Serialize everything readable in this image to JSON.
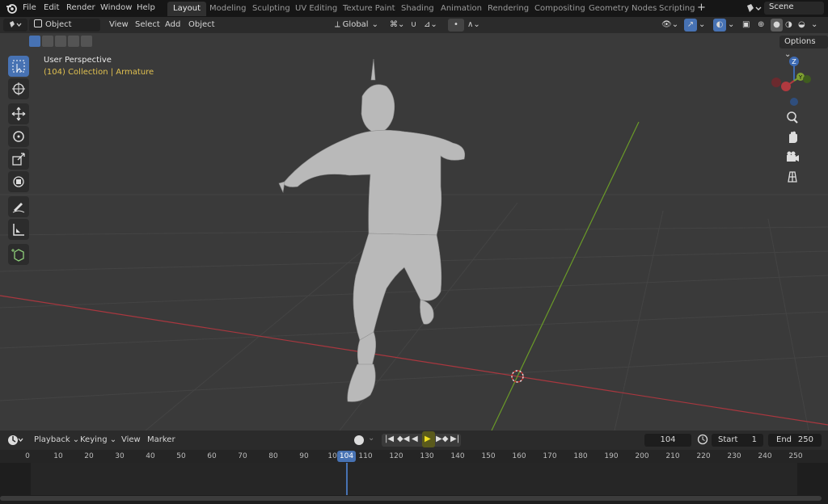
{
  "menu": {
    "items": [
      "File",
      "Edit",
      "Render",
      "Window",
      "Help"
    ]
  },
  "workspaces": [
    "Layout",
    "Modeling",
    "Sculpting",
    "UV Editing",
    "Texture Paint",
    "Shading",
    "Animation",
    "Rendering",
    "Compositing",
    "Geometry Nodes",
    "Scripting"
  ],
  "active_workspace": "Layout",
  "scene": {
    "label": "Scene"
  },
  "viewport_header": {
    "mode": "Object Mode",
    "menus": [
      "View",
      "Select",
      "Add",
      "Object"
    ],
    "orientation": "Global",
    "options": "Options"
  },
  "overlay": {
    "view_name": "User Perspective",
    "collection_info": "(104) Collection | Armature"
  },
  "gizmo": {
    "z": "Z",
    "y": "Y"
  },
  "tools": [
    "select-box",
    "cursor",
    "move",
    "rotate",
    "scale",
    "transform",
    "annotate",
    "measure",
    "add-cube"
  ],
  "timeline": {
    "menus": [
      "Playback",
      "Keying",
      "View",
      "Marker"
    ],
    "current_frame": "104",
    "start_label": "Start",
    "start": "1",
    "end_label": "End",
    "end": "250",
    "ticks": [
      "0",
      "10",
      "20",
      "30",
      "40",
      "50",
      "60",
      "70",
      "80",
      "90",
      "100",
      "110",
      "120",
      "130",
      "140",
      "150",
      "160",
      "170",
      "180",
      "190",
      "200",
      "210",
      "220",
      "230",
      "240",
      "250"
    ],
    "playhead_label": "104"
  },
  "colors": {
    "accent": "#4772b3",
    "x_axis": "#b3383f",
    "y_axis": "#6a9a28",
    "overlay_text": "#e0c050"
  }
}
